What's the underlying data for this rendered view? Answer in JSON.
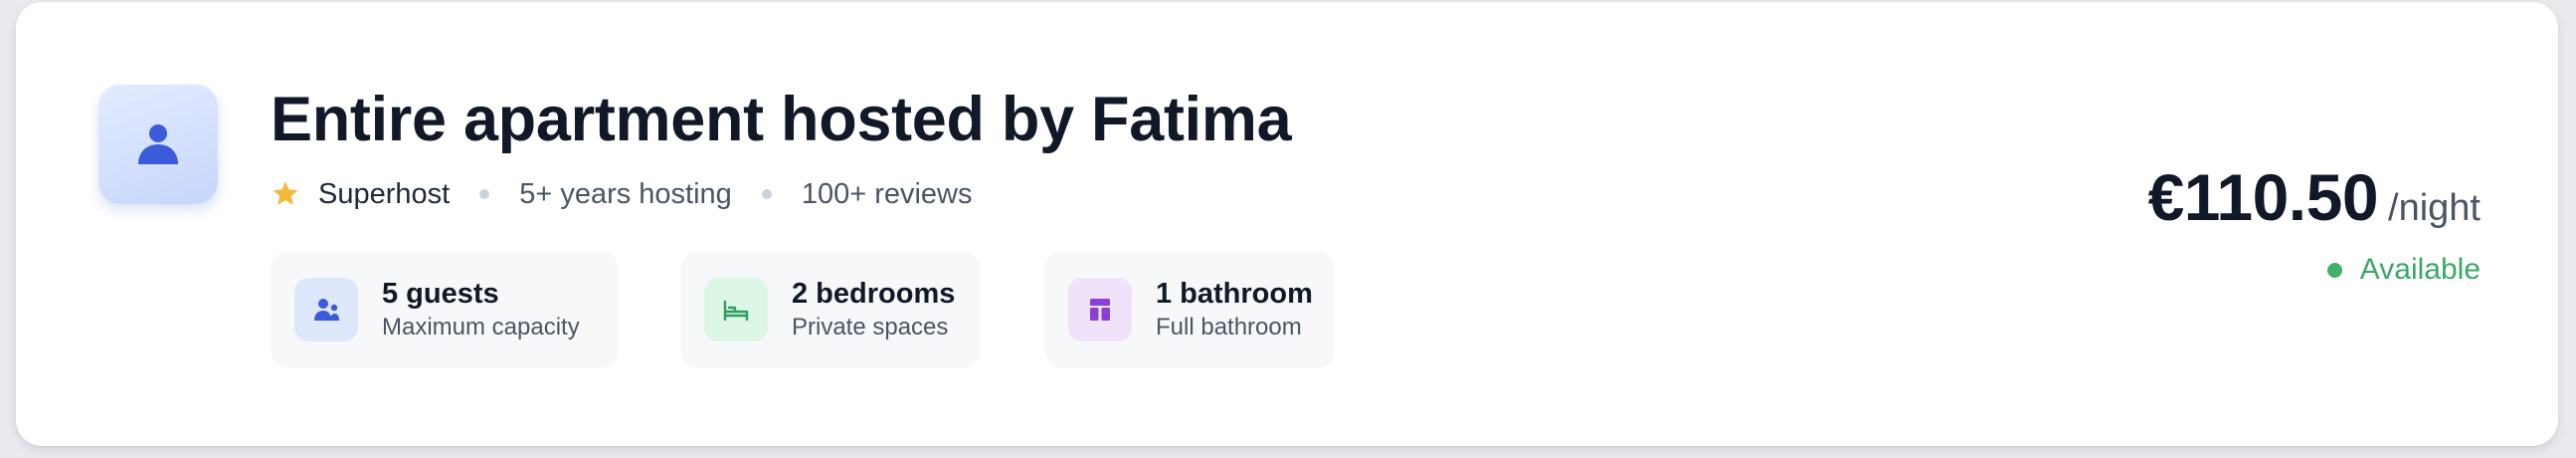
{
  "listing": {
    "title": "Entire apartment hosted by Fatima",
    "avatar_icon": "user-icon",
    "meta": {
      "badge_icon": "star-icon",
      "badge_label": "Superhost",
      "hosting_years": "5+ years hosting",
      "reviews": "100+ reviews"
    },
    "features": [
      {
        "icon": "guests-icon",
        "value": "5 guests",
        "caption": "Maximum capacity",
        "color": "#3b5bdb"
      },
      {
        "icon": "bed-icon",
        "value": "2 bedrooms",
        "caption": "Private spaces",
        "color": "#2f9e5a"
      },
      {
        "icon": "bathroom-icon",
        "value": "1 bathroom",
        "caption": "Full bathroom",
        "color": "#8b3fd9"
      }
    ]
  },
  "pricing": {
    "amount": "€110.50",
    "unit": "/night",
    "status": "Available",
    "status_color": "#43b06a"
  },
  "colors": {
    "accent": "#3b5bdb",
    "star": "#f5b83d",
    "title": "#111827"
  }
}
